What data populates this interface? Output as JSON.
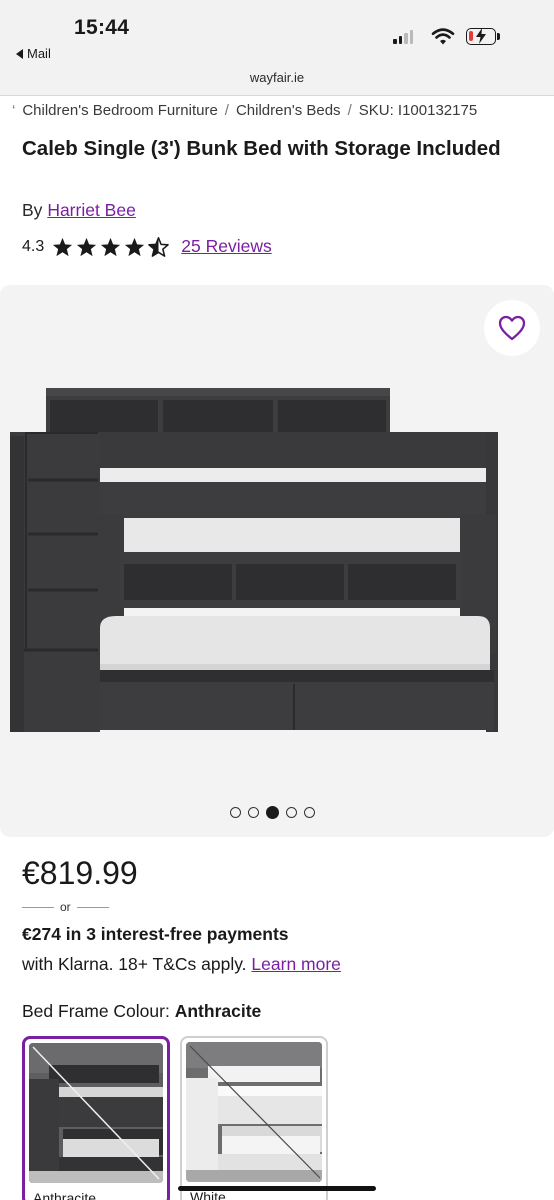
{
  "status_bar": {
    "time": "15:44",
    "back_app": "Mail",
    "signal_icon": "cellular-signal-icon",
    "wifi_icon": "wifi-icon",
    "battery_icon": "battery-charging-icon"
  },
  "browser": {
    "url": "wayfair.ie"
  },
  "breadcrumb": {
    "items": [
      "Children's Bedroom Furniture",
      "Children's Beds",
      "SKU: I100132175"
    ],
    "separator": "/"
  },
  "product": {
    "title": "Caleb Single (3') Bunk Bed with Storage Included",
    "by_label": "By",
    "brand": "Harriet Bee",
    "rating": "4.3",
    "rating_value": 4.3,
    "rating_max": 5,
    "reviews_link": "25 Reviews"
  },
  "gallery": {
    "favorite_icon": "heart-outline-icon",
    "image_count": 5,
    "active_index": 2
  },
  "pricing": {
    "price": "€819.99",
    "or_text": "or",
    "installments": "€274 in 3 interest-free payments",
    "klarna_text": "with Klarna. 18+ T&Cs apply.",
    "learn_more": "Learn more"
  },
  "options": {
    "colour_label": "Bed Frame Colour:",
    "selected_colour": "Anthracite",
    "swatches": [
      {
        "label": "Anthracite",
        "selected": true
      },
      {
        "label": "White",
        "selected": false
      }
    ]
  },
  "colors": {
    "accent": "#7b1fa2",
    "bed_frame": "#3d3d3f",
    "gallery_bg": "#f3f3f3"
  }
}
